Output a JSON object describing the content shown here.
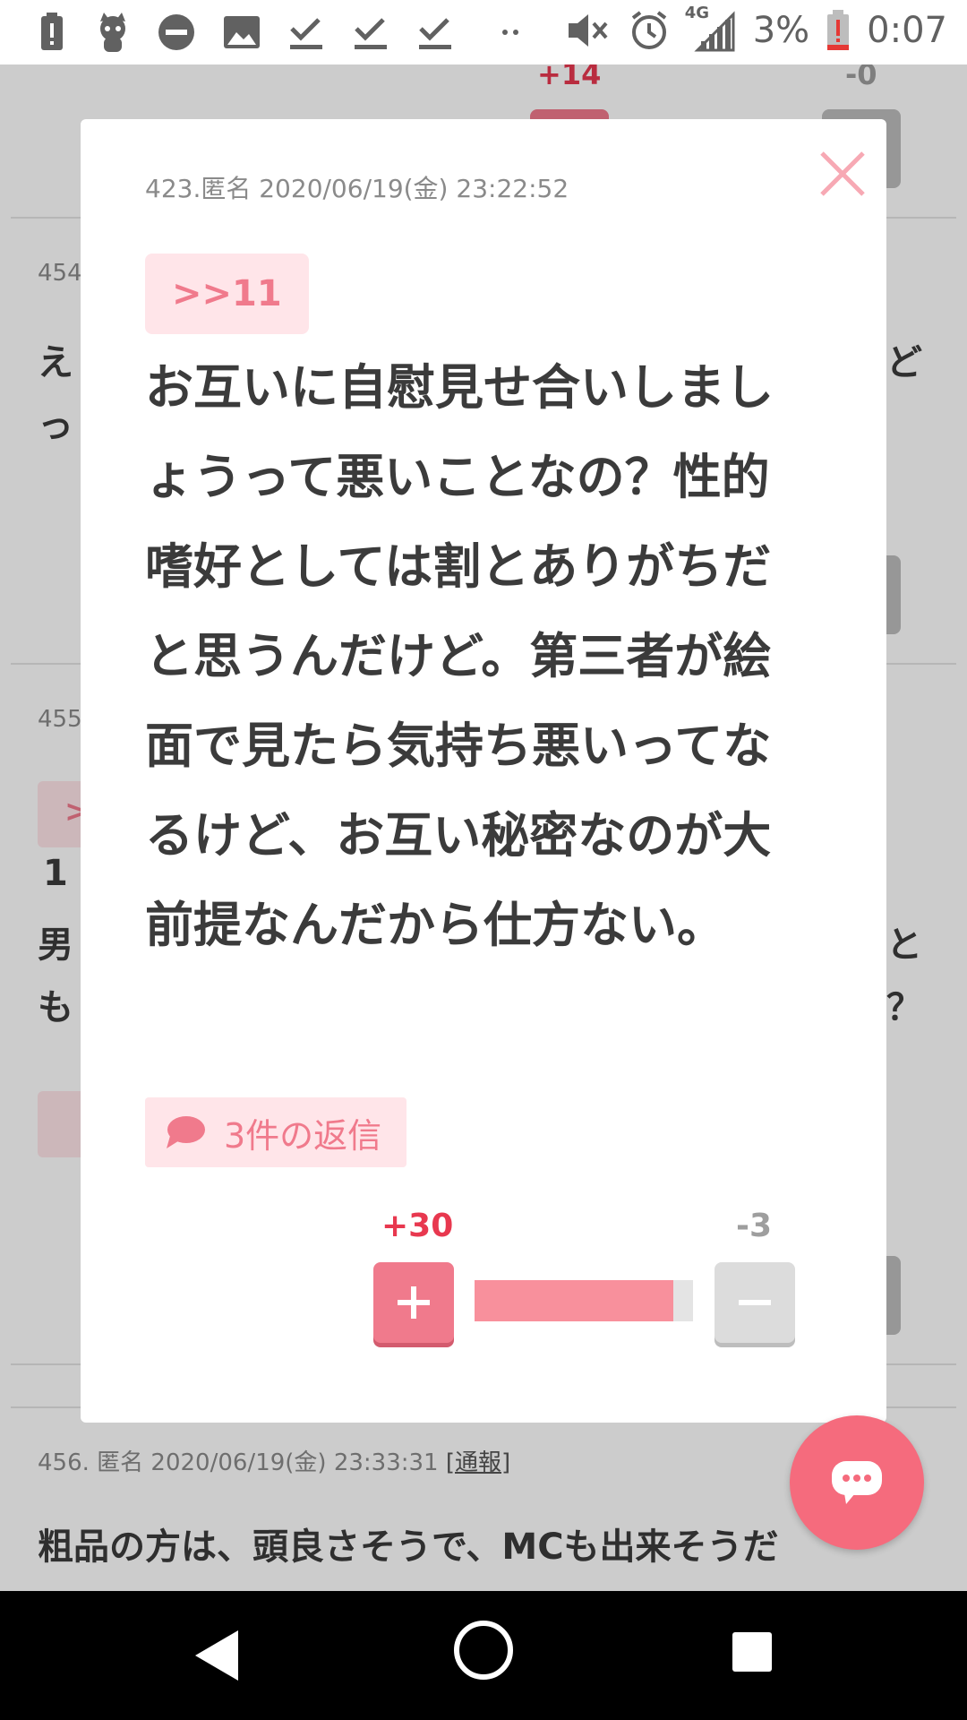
{
  "status_bar": {
    "icons": [
      "battery-alert-icon",
      "mascot-icon",
      "do-not-disturb-icon",
      "image-icon",
      "download-done-icon",
      "download-done-icon",
      "download-done-icon",
      "more-dots-icon"
    ],
    "right_icons": [
      "volume-mute-icon",
      "alarm-icon",
      "signal-4g-icon"
    ],
    "network_label": "4G",
    "battery_percent": "3%",
    "time": "0:07"
  },
  "background_page": {
    "top_vote_plus": "+14",
    "top_vote_minus": "-0",
    "comment_454_no": "454",
    "comment_454_text_left": [
      "え",
      "っ"
    ],
    "comment_454_text_right": "ど",
    "comment_455_no": "455",
    "comment_455_tag": ">",
    "comment_455_text_left": [
      "1",
      "男",
      "も"
    ],
    "comment_455_text_right": [
      "と",
      "？"
    ],
    "comment_456_meta": "456. 匿名 2020/06/19(金) 23:33:31",
    "comment_456_report": "[通報]",
    "comment_456_text": "粗品の方は、頭良さそうで、MCも出来そうだ"
  },
  "modal": {
    "meta": "423.匿名 2020/06/19(金) 23:22:52",
    "quote": ">>11",
    "body": "お互いに自慰見せ合いしましょうって悪いことなの？性的嗜好としては割とありがちだと思うんだけど。第三者が絵面で見たら気持ち悪いってなるけど、お互い秘密なのが大前提なんだから仕方ない。",
    "reply_label": "3件の返信",
    "vote_plus": "+30",
    "vote_minus": "-3",
    "vote_ratio": 0.909,
    "close_icon": "close-icon"
  },
  "fab": {
    "icon": "chat-bubble-icon"
  },
  "nav": {
    "icons": [
      "back-icon",
      "home-icon",
      "recents-icon"
    ]
  },
  "colors": {
    "accent": "#f07a8c",
    "accent_light": "#ffe5e9",
    "plus_red": "#e8384f",
    "minus_gray": "#9e9e9e",
    "text_dark": "#3b3b3b"
  }
}
